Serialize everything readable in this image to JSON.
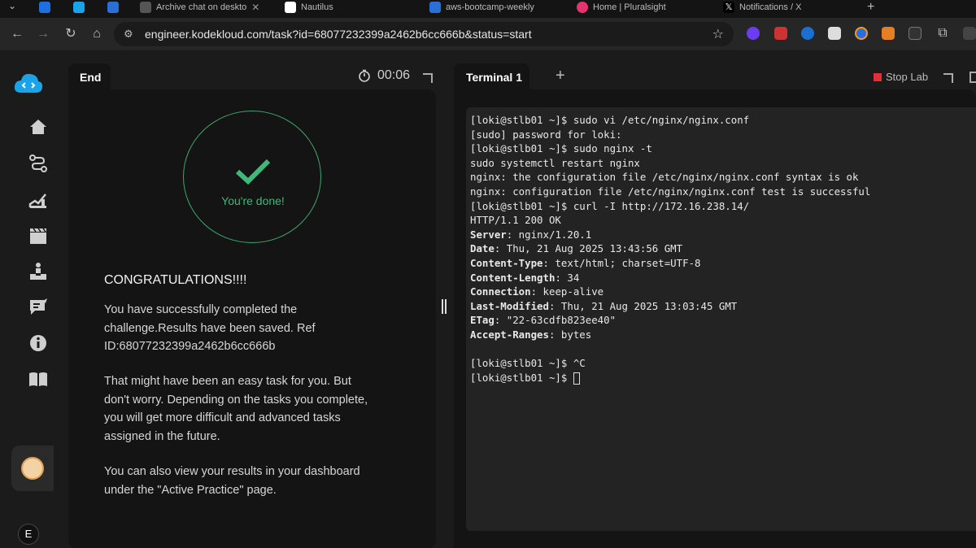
{
  "browser": {
    "tabs": [
      {
        "label": "Archive chat on deskto",
        "color": "#555555"
      },
      {
        "label": "Nautilus",
        "color": "#ffffff"
      },
      {
        "label": "aws-bootcamp-weekly",
        "color": "#2a6fd6"
      },
      {
        "label": "Home | Pluralsight",
        "color": "#e8316e"
      },
      {
        "label": "Notifications / X",
        "color": "#000000"
      }
    ],
    "url": "engineer.kodekloud.com/task?id=68077232399a2462b6cc666b&status=start"
  },
  "left_panel": {
    "tab_label": "End",
    "timer": "00:06",
    "done_text": "You're done!",
    "title": "CONGRATULATIONS!!!!",
    "paragraph1": [
      "You have successfully completed the",
      "challenge.Results have been saved. Ref",
      "ID:68077232399a2462b6cc666b"
    ],
    "paragraph2": [
      "That might have been an easy task for you. But",
      "don't worry. Depending on the tasks you complete,",
      "you will get more difficult and advanced tasks",
      "assigned in the future."
    ],
    "paragraph3": [
      "You can also view your results in your dashboard",
      "under the \"Active Practice\" page."
    ]
  },
  "right_panel": {
    "tab_label": "Terminal 1",
    "stop_label": "Stop Lab",
    "lines": [
      {
        "plain": "[loki@stlb01 ~]$ sudo vi /etc/nginx/nginx.conf"
      },
      {
        "plain": "[sudo] password for loki:"
      },
      {
        "plain": "[loki@stlb01 ~]$ sudo nginx -t"
      },
      {
        "plain": "sudo systemctl restart nginx"
      },
      {
        "plain": "nginx: the configuration file /etc/nginx/nginx.conf syntax is ok"
      },
      {
        "plain": "nginx: configuration file /etc/nginx/nginx.conf test is successful"
      },
      {
        "plain": "[loki@stlb01 ~]$ curl -I http://172.16.238.14/"
      },
      {
        "plain": "HTTP/1.1 200 OK"
      },
      {
        "key": "Server",
        "value": ": nginx/1.20.1"
      },
      {
        "key": "Date",
        "value": ": Thu, 21 Aug 2025 13:43:56 GMT"
      },
      {
        "key": "Content-Type",
        "value": ": text/html; charset=UTF-8"
      },
      {
        "key": "Content-Length",
        "value": ": 34"
      },
      {
        "key": "Connection",
        "value": ": keep-alive"
      },
      {
        "key": "Last-Modified",
        "value": ": Thu, 21 Aug 2025 13:03:45 GMT"
      },
      {
        "key": "ETag",
        "value": ": \"22-63cdfb823ee40\""
      },
      {
        "key": "Accept-Ranges",
        "value": ": bytes"
      },
      {
        "plain": ""
      },
      {
        "plain": "[loki@stlb01 ~]$ ^C"
      },
      {
        "plain": "[loki@stlb01 ~]$ ",
        "cursor": true
      }
    ]
  },
  "sidebar": {
    "icons": [
      "home-icon",
      "route-icon",
      "chart-icon",
      "video-icon",
      "community-icon",
      "chat-icon",
      "info-icon",
      "book-icon"
    ],
    "user_initial": "E"
  },
  "colors": {
    "accent_green": "#3fb879",
    "stop_red": "#e03030",
    "logo_blue": "#1aa3e8"
  }
}
